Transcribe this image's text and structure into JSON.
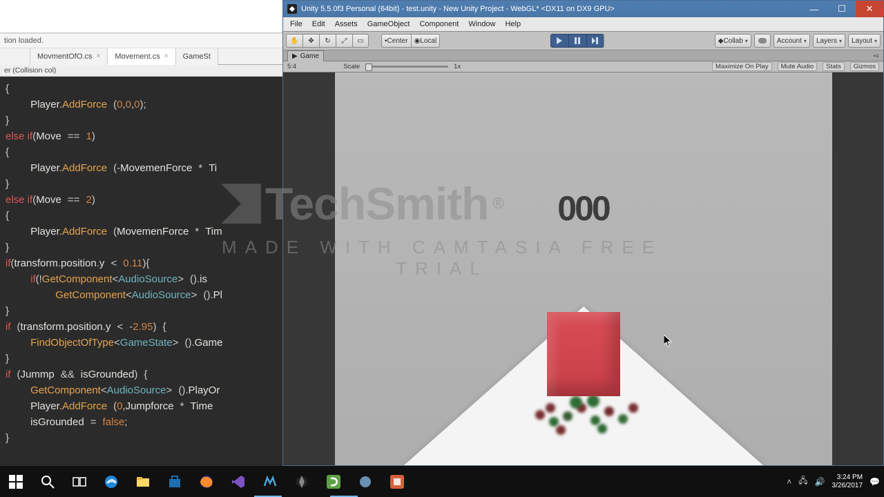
{
  "editor": {
    "status_line": "tion loaded.",
    "tabs": [
      {
        "label": "MovmentOfO.cs",
        "active": false
      },
      {
        "label": "Movement.cs",
        "active": true
      },
      {
        "label": "GameSt",
        "active": false
      }
    ],
    "sub_line": "er (Collision col)"
  },
  "unity": {
    "title": "Unity 5.5.0f3 Personal (64bit) - test.unity - New Unity Project - WebGL* <DX11 on DX9 GPU>",
    "menus": [
      "File",
      "Edit",
      "Assets",
      "GameObject",
      "Component",
      "Window",
      "Help"
    ],
    "toolbar": {
      "pivot": "Center",
      "space": "Local",
      "collab": "Collab",
      "account": "Account",
      "layers": "Layers",
      "layout": "Layout"
    },
    "game_tab": "Game",
    "game_toolbar": {
      "aspect": "5:4",
      "scale_label": "Scale",
      "scale_value": "1x",
      "right_buttons": [
        "Maximize On Play",
        "Mute Audio",
        "Stats",
        "Gizmos"
      ]
    },
    "score": "000"
  },
  "watermark": {
    "brand": "TechSmith",
    "reg": "®",
    "sub": "MADE WITH CAMTASIA FREE TRIAL"
  },
  "taskbar": {
    "time": "3:24 PM",
    "date": "3/26/2017"
  }
}
